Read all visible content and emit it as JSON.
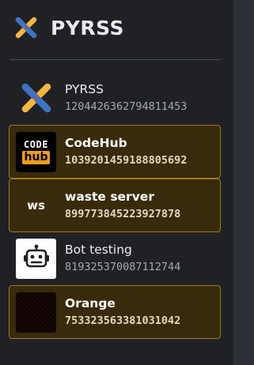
{
  "app": {
    "title": "PYRSS"
  },
  "servers": [
    {
      "name": "PYRSS",
      "id": "1204426362794811453",
      "avatar": "pyrss-logo-icon",
      "highlighted": false
    },
    {
      "name": "CodeHub",
      "id": "1039201459188805692",
      "avatar": "codehub-logo-icon",
      "avatar_text_top": "CODE",
      "avatar_text_bottom": "hub",
      "highlighted": true
    },
    {
      "name": "waste server",
      "id": "899773845223927878",
      "avatar": "ws-initials-icon",
      "avatar_text": "ws",
      "highlighted": true
    },
    {
      "name": "Bot testing",
      "id": "819325370087112744",
      "avatar": "robot-icon",
      "highlighted": false
    },
    {
      "name": "Orange",
      "id": "753323563381031042",
      "avatar": "orange-pattern-icon",
      "highlighted": true
    }
  ],
  "colors": {
    "sidebar_bg": "#1f2125",
    "highlight_bg": "#382b0b",
    "highlight_border": "#a07a14",
    "accent_orange": "#f19a1b"
  }
}
